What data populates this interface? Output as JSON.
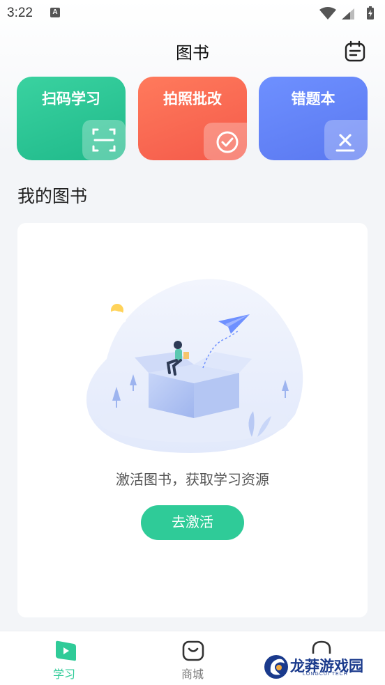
{
  "status_bar": {
    "time": "3:22",
    "notification_glyph": "A",
    "colors": {
      "text": "#333333"
    }
  },
  "header": {
    "title": "图书",
    "calendar_icon": "calendar-icon"
  },
  "features": [
    {
      "label": "扫码学习",
      "icon": "scan-icon",
      "color": "#2dc796"
    },
    {
      "label": "拍照批改",
      "icon": "camera-check-icon",
      "color": "#f86651"
    },
    {
      "label": "错题本",
      "icon": "wrong-book-icon",
      "color": "#6484f8"
    }
  ],
  "my_books": {
    "title": "我的图书",
    "empty_text": "激活图书，获取学习资源",
    "activate_button": "去激活"
  },
  "tab_bar": {
    "items": [
      {
        "label": "学习",
        "icon": "play-book-icon",
        "active": true
      },
      {
        "label": "商城",
        "icon": "shopping-bag-icon",
        "active": false
      },
      {
        "label": "",
        "icon": "profile-icon",
        "active": false
      }
    ],
    "accent_color": "#2fcb98"
  },
  "watermark": {
    "text": "龙莽游戏园",
    "subtext": "LONGCUI TECH"
  }
}
